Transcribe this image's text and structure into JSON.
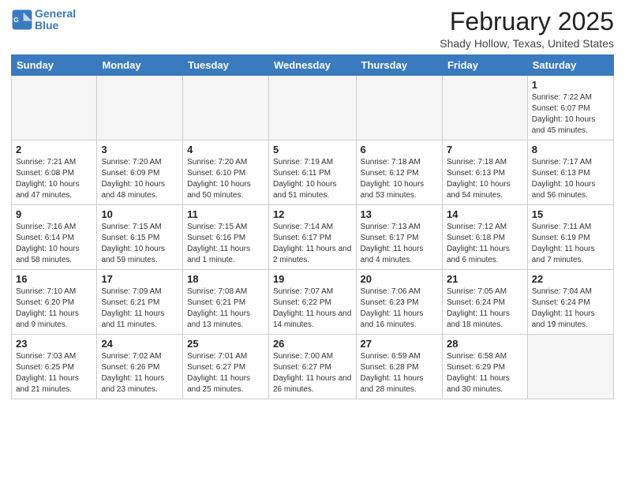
{
  "header": {
    "logo_line1": "General",
    "logo_line2": "Blue",
    "month": "February 2025",
    "location": "Shady Hollow, Texas, United States"
  },
  "weekdays": [
    "Sunday",
    "Monday",
    "Tuesday",
    "Wednesday",
    "Thursday",
    "Friday",
    "Saturday"
  ],
  "weeks": [
    [
      {
        "day": "",
        "info": ""
      },
      {
        "day": "",
        "info": ""
      },
      {
        "day": "",
        "info": ""
      },
      {
        "day": "",
        "info": ""
      },
      {
        "day": "",
        "info": ""
      },
      {
        "day": "",
        "info": ""
      },
      {
        "day": "1",
        "info": "Sunrise: 7:22 AM\nSunset: 6:07 PM\nDaylight: 10 hours and 45 minutes."
      }
    ],
    [
      {
        "day": "2",
        "info": "Sunrise: 7:21 AM\nSunset: 6:08 PM\nDaylight: 10 hours and 47 minutes."
      },
      {
        "day": "3",
        "info": "Sunrise: 7:20 AM\nSunset: 6:09 PM\nDaylight: 10 hours and 48 minutes."
      },
      {
        "day": "4",
        "info": "Sunrise: 7:20 AM\nSunset: 6:10 PM\nDaylight: 10 hours and 50 minutes."
      },
      {
        "day": "5",
        "info": "Sunrise: 7:19 AM\nSunset: 6:11 PM\nDaylight: 10 hours and 51 minutes."
      },
      {
        "day": "6",
        "info": "Sunrise: 7:18 AM\nSunset: 6:12 PM\nDaylight: 10 hours and 53 minutes."
      },
      {
        "day": "7",
        "info": "Sunrise: 7:18 AM\nSunset: 6:13 PM\nDaylight: 10 hours and 54 minutes."
      },
      {
        "day": "8",
        "info": "Sunrise: 7:17 AM\nSunset: 6:13 PM\nDaylight: 10 hours and 56 minutes."
      }
    ],
    [
      {
        "day": "9",
        "info": "Sunrise: 7:16 AM\nSunset: 6:14 PM\nDaylight: 10 hours and 58 minutes."
      },
      {
        "day": "10",
        "info": "Sunrise: 7:15 AM\nSunset: 6:15 PM\nDaylight: 10 hours and 59 minutes."
      },
      {
        "day": "11",
        "info": "Sunrise: 7:15 AM\nSunset: 6:16 PM\nDaylight: 11 hours and 1 minute."
      },
      {
        "day": "12",
        "info": "Sunrise: 7:14 AM\nSunset: 6:17 PM\nDaylight: 11 hours and 2 minutes."
      },
      {
        "day": "13",
        "info": "Sunrise: 7:13 AM\nSunset: 6:17 PM\nDaylight: 11 hours and 4 minutes."
      },
      {
        "day": "14",
        "info": "Sunrise: 7:12 AM\nSunset: 6:18 PM\nDaylight: 11 hours and 6 minutes."
      },
      {
        "day": "15",
        "info": "Sunrise: 7:11 AM\nSunset: 6:19 PM\nDaylight: 11 hours and 7 minutes."
      }
    ],
    [
      {
        "day": "16",
        "info": "Sunrise: 7:10 AM\nSunset: 6:20 PM\nDaylight: 11 hours and 9 minutes."
      },
      {
        "day": "17",
        "info": "Sunrise: 7:09 AM\nSunset: 6:21 PM\nDaylight: 11 hours and 11 minutes."
      },
      {
        "day": "18",
        "info": "Sunrise: 7:08 AM\nSunset: 6:21 PM\nDaylight: 11 hours and 13 minutes."
      },
      {
        "day": "19",
        "info": "Sunrise: 7:07 AM\nSunset: 6:22 PM\nDaylight: 11 hours and 14 minutes."
      },
      {
        "day": "20",
        "info": "Sunrise: 7:06 AM\nSunset: 6:23 PM\nDaylight: 11 hours and 16 minutes."
      },
      {
        "day": "21",
        "info": "Sunrise: 7:05 AM\nSunset: 6:24 PM\nDaylight: 11 hours and 18 minutes."
      },
      {
        "day": "22",
        "info": "Sunrise: 7:04 AM\nSunset: 6:24 PM\nDaylight: 11 hours and 19 minutes."
      }
    ],
    [
      {
        "day": "23",
        "info": "Sunrise: 7:03 AM\nSunset: 6:25 PM\nDaylight: 11 hours and 21 minutes."
      },
      {
        "day": "24",
        "info": "Sunrise: 7:02 AM\nSunset: 6:26 PM\nDaylight: 11 hours and 23 minutes."
      },
      {
        "day": "25",
        "info": "Sunrise: 7:01 AM\nSunset: 6:27 PM\nDaylight: 11 hours and 25 minutes."
      },
      {
        "day": "26",
        "info": "Sunrise: 7:00 AM\nSunset: 6:27 PM\nDaylight: 11 hours and 26 minutes."
      },
      {
        "day": "27",
        "info": "Sunrise: 6:59 AM\nSunset: 6:28 PM\nDaylight: 11 hours and 28 minutes."
      },
      {
        "day": "28",
        "info": "Sunrise: 6:58 AM\nSunset: 6:29 PM\nDaylight: 11 hours and 30 minutes."
      },
      {
        "day": "",
        "info": ""
      }
    ]
  ]
}
